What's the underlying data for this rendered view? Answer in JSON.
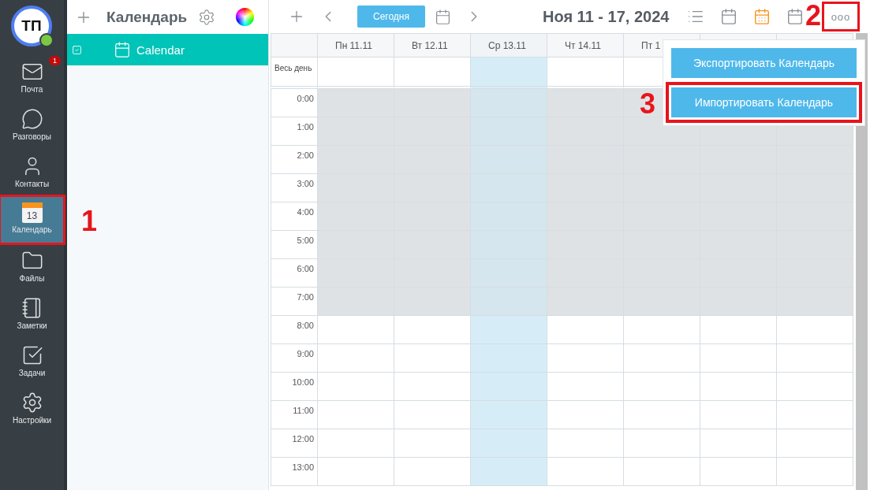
{
  "user": {
    "initials": "ТП",
    "online": true
  },
  "nav": [
    {
      "kind": "mail",
      "label": "Почта",
      "badge": "1",
      "selected": false
    },
    {
      "kind": "chat",
      "label": "Разговоры",
      "selected": false
    },
    {
      "kind": "contacts",
      "label": "Контакты",
      "selected": false
    },
    {
      "kind": "calendar",
      "label": "Календарь",
      "day": "13",
      "selected": true,
      "annotation": "1"
    },
    {
      "kind": "files",
      "label": "Файлы",
      "selected": false
    },
    {
      "kind": "notes",
      "label": "Заметки",
      "selected": false
    },
    {
      "kind": "tasks",
      "label": "Задачи",
      "selected": false
    },
    {
      "kind": "settings",
      "label": "Настройки",
      "selected": false
    }
  ],
  "panel": {
    "title": "Календарь",
    "calendars": [
      {
        "name": "Calendar",
        "checked": true
      }
    ]
  },
  "toolbar": {
    "today_button": "Сегодня",
    "range_title": "Ноя 11 - 17, 2024",
    "views": [
      {
        "kind": "list",
        "selected": false
      },
      {
        "kind": "day",
        "selected": false
      },
      {
        "kind": "week",
        "selected": true
      },
      {
        "kind": "month",
        "selected": false
      }
    ],
    "more_button": {
      "label": "ooo",
      "annotation": "2"
    }
  },
  "days": [
    {
      "label": "Пн 11.11",
      "today": false
    },
    {
      "label": "Вт 12.11",
      "today": false
    },
    {
      "label": "Ср 13.11",
      "today": true
    },
    {
      "label": "Чт 14.11",
      "today": false
    },
    {
      "label": "Пт 1",
      "today": false
    },
    {
      "today": false
    },
    {
      "today": false
    }
  ],
  "all_day_label": "Весь день",
  "hours": [
    {
      "label": "0:00",
      "off_hours": true
    },
    {
      "label": "1:00",
      "off_hours": true
    },
    {
      "label": "2:00",
      "off_hours": true
    },
    {
      "label": "3:00",
      "off_hours": true
    },
    {
      "label": "4:00",
      "off_hours": true
    },
    {
      "label": "5:00",
      "off_hours": true
    },
    {
      "label": "6:00",
      "off_hours": true
    },
    {
      "label": "7:00",
      "off_hours": true
    },
    {
      "label": "8:00",
      "off_hours": false
    },
    {
      "label": "9:00",
      "off_hours": false
    },
    {
      "label": "10:00",
      "off_hours": false
    },
    {
      "label": "11:00",
      "off_hours": false
    },
    {
      "label": "12:00",
      "off_hours": false
    },
    {
      "label": "13:00",
      "off_hours": false
    }
  ],
  "menu": [
    {
      "label": "Экспортировать Календарь"
    },
    {
      "label": "Импортировать Календарь",
      "annotation": "3"
    }
  ]
}
